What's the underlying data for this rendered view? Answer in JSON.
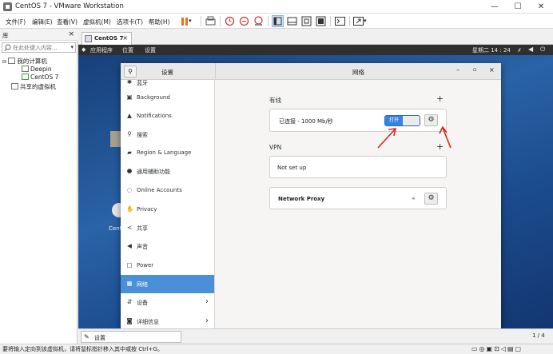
{
  "window": {
    "title": "CentOS 7 - VMware Workstation",
    "minimize": "—",
    "maximize": "☐",
    "close": "✕"
  },
  "menubar": {
    "items": [
      "文件(F)",
      "编辑(E)",
      "查看(V)",
      "虚拟机(M)",
      "选项卡(T)",
      "帮助(H)"
    ]
  },
  "library": {
    "title": "库",
    "close": "×",
    "search_placeholder": "在此处键入内容...",
    "tree": [
      {
        "label": "我的计算机"
      },
      {
        "label": "Deepin"
      },
      {
        "label": "CentOS 7"
      },
      {
        "label": "共享的虚拟机"
      }
    ]
  },
  "tab": {
    "label": "CentOS 7",
    "close": "×"
  },
  "gnome_bar": {
    "apps": "应用程序",
    "places": "位置",
    "settings": "设置",
    "clock": "星期二 14 : 24"
  },
  "desktop": {
    "icon_label": "Cent"
  },
  "settings": {
    "sidebar_title": "设置",
    "panel_title": "网络",
    "sidebar_items": [
      {
        "label": "蓝牙",
        "icon": "bluetooth-icon",
        "glyph": "✱"
      },
      {
        "label": "Background",
        "icon": "background-icon",
        "glyph": "▣"
      },
      {
        "label": "Notifications",
        "icon": "bell-icon",
        "glyph": "▲"
      },
      {
        "label": "搜索",
        "icon": "search-icon",
        "glyph": "⚲"
      },
      {
        "label": "Region & Language",
        "icon": "region-icon",
        "glyph": "▰"
      },
      {
        "label": "通用辅助功能",
        "icon": "accessibility-icon",
        "glyph": "●"
      },
      {
        "label": "Online Accounts",
        "icon": "online-accounts-icon",
        "glyph": "◌"
      },
      {
        "label": "Privacy",
        "icon": "privacy-icon",
        "glyph": "✋"
      },
      {
        "label": "共享",
        "icon": "share-icon",
        "glyph": "≺"
      },
      {
        "label": "声音",
        "icon": "sound-icon",
        "glyph": "◀"
      },
      {
        "label": "Power",
        "icon": "power-icon",
        "glyph": "▢"
      },
      {
        "label": "网络",
        "icon": "network-icon",
        "glyph": "▦",
        "active": true
      },
      {
        "label": "设备",
        "icon": "devices-icon",
        "glyph": "⇵",
        "chevron": "›"
      },
      {
        "label": "详细信息",
        "icon": "details-icon",
        "glyph": "◙",
        "chevron": "›"
      }
    ],
    "wired": {
      "heading": "有线",
      "add": "+",
      "status": "已连接 - 1000 Mb/秒",
      "toggle_label": "打开",
      "toggle_on": true
    },
    "vpn": {
      "heading": "VPN",
      "add": "+",
      "empty": "Not set up"
    },
    "proxy": {
      "label": "Network Proxy",
      "status_glyph": "⚹"
    }
  },
  "statusbar": {
    "tab_label": "设置",
    "page": "1 / 4"
  },
  "bottom": {
    "hint": "要将输入定向到该虚拟机，请将鼠标指针移入其中或按 Ctrl+G。"
  },
  "colors": {
    "accent": "#4a90d9",
    "annotation_arrow": "#e2231a",
    "pause": "#e8731c"
  }
}
